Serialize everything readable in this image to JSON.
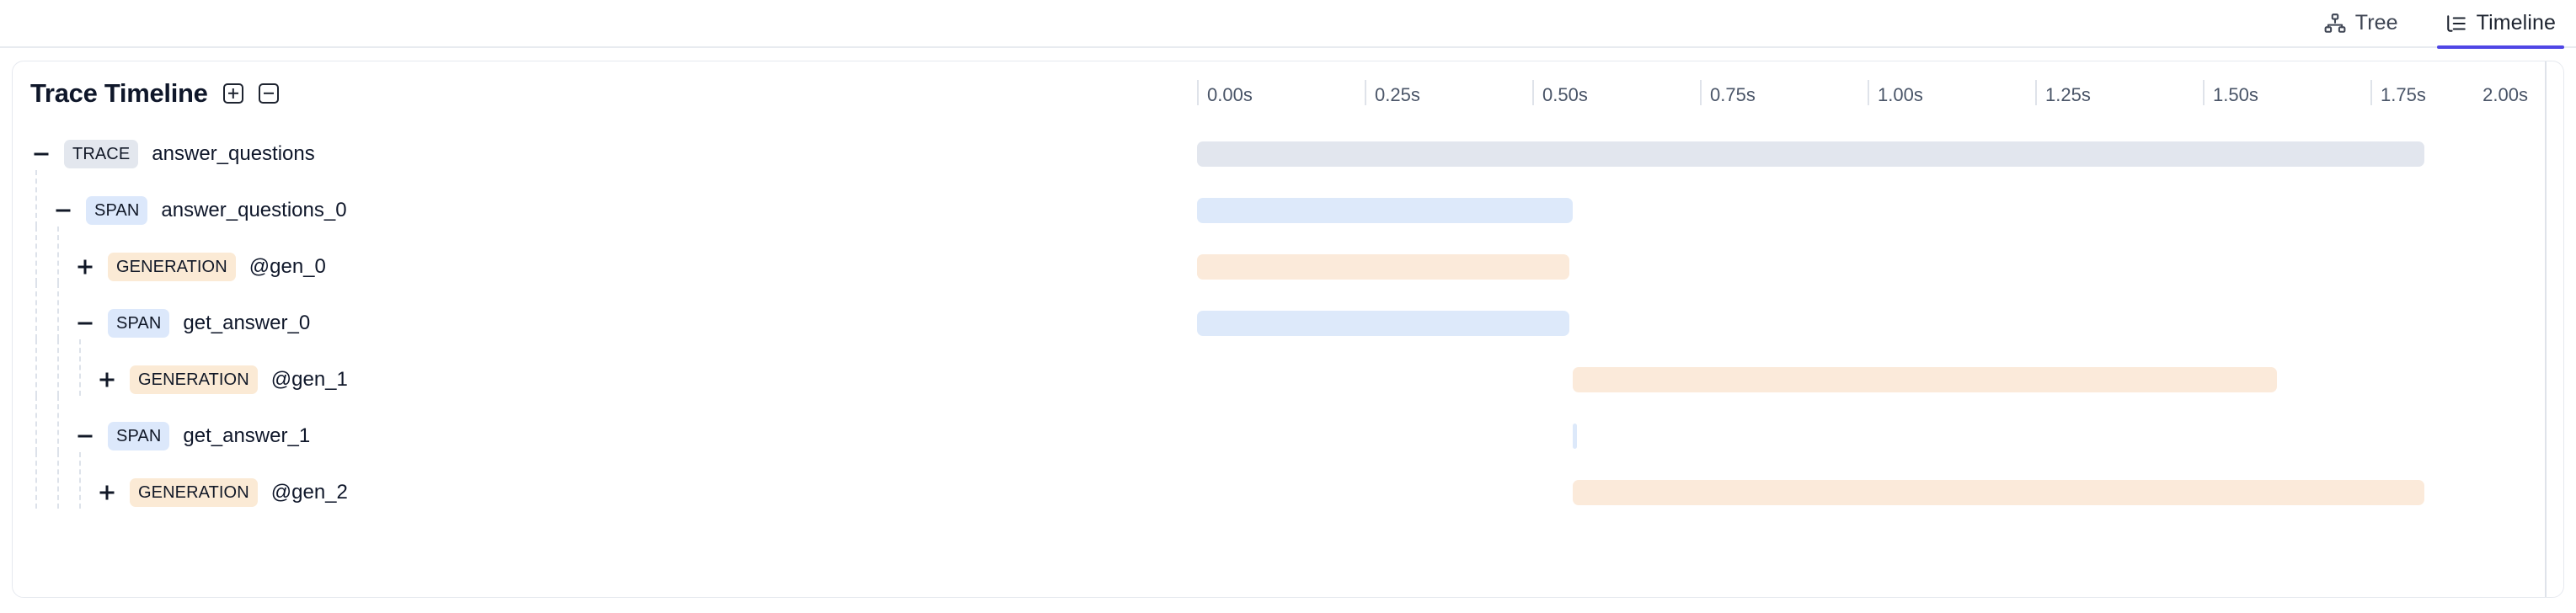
{
  "tabs": [
    {
      "id": "tree",
      "label": "Tree",
      "icon": "tree-hierarchy-icon",
      "active": false
    },
    {
      "id": "timeline",
      "label": "Timeline",
      "icon": "timeline-list-icon",
      "active": true
    }
  ],
  "accent_color": "#4f46e5",
  "panel": {
    "title": "Trace Timeline",
    "expand_all_label": "Expand all",
    "collapse_all_label": "Collapse all"
  },
  "axis": {
    "unit": "s",
    "min": 0.0,
    "max": 2.0,
    "ticks": [
      "0.00s",
      "0.25s",
      "0.50s",
      "0.75s",
      "1.00s",
      "1.25s",
      "1.50s",
      "1.75s",
      "2.00s"
    ]
  },
  "rows": [
    {
      "type_label": "TRACE",
      "type_class": "trace",
      "name": "answer_questions",
      "depth": 0,
      "toggle": "minus",
      "start_s": 0.0,
      "end_s": 1.83,
      "bar_class": "trace"
    },
    {
      "type_label": "SPAN",
      "type_class": "span",
      "name": "answer_questions_0",
      "depth": 1,
      "toggle": "minus",
      "start_s": 0.0,
      "end_s": 0.56,
      "bar_class": "span"
    },
    {
      "type_label": "GENERATION",
      "type_class": "generation",
      "name": "@gen_0",
      "depth": 2,
      "toggle": "plus",
      "start_s": 0.0,
      "end_s": 0.555,
      "bar_class": "generation"
    },
    {
      "type_label": "SPAN",
      "type_class": "span",
      "name": "get_answer_0",
      "depth": 2,
      "toggle": "minus",
      "start_s": 0.0,
      "end_s": 0.555,
      "bar_class": "span"
    },
    {
      "type_label": "GENERATION",
      "type_class": "generation",
      "name": "@gen_1",
      "depth": 3,
      "toggle": "plus",
      "start_s": 0.56,
      "end_s": 1.61,
      "bar_class": "generation"
    },
    {
      "type_label": "SPAN",
      "type_class": "span",
      "name": "get_answer_1",
      "depth": 2,
      "toggle": "minus",
      "start_s": 0.56,
      "end_s": 0.566,
      "bar_class": "span sliver"
    },
    {
      "type_label": "GENERATION",
      "type_class": "generation",
      "name": "@gen_2",
      "depth": 3,
      "toggle": "plus",
      "start_s": 0.56,
      "end_s": 1.83,
      "bar_class": "generation"
    }
  ]
}
